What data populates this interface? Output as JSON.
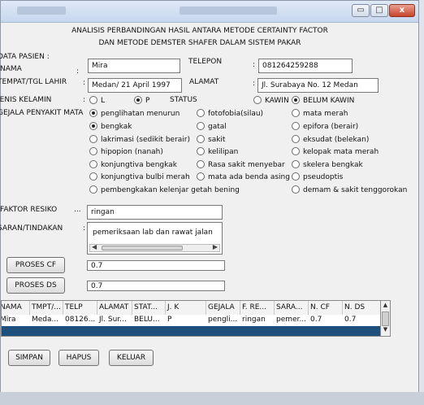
{
  "header": {
    "title_line1": "ANALISIS PERBANDINGAN HASIL ANTARA METODE CERTAINTY FACTOR",
    "title_line2": "DAN METODE DEMSTER SHAFER DALAM SISTEM PAKAR"
  },
  "window_controls": {
    "minimize": "▭",
    "maximize": "□",
    "close": "x"
  },
  "patient": {
    "section_label": "DATA PASIEN :",
    "nama_label": "NAMA",
    "nama_value": "Mira",
    "telepon_label": "TELEPON",
    "telepon_value": "081264259288",
    "ttl_label": "TEMPAT/TGL LAHIR",
    "ttl_value": "Medan/ 21 April 1997",
    "alamat_label": "ALAMAT",
    "alamat_value": "Jl. Surabaya No. 12 Medan",
    "jk_label": "JENIS KELAMIN",
    "jk_options": [
      "L",
      "P"
    ],
    "jk_selected": "P",
    "status_label": "STATUS",
    "status_options": [
      "KAWIN",
      "BELUM KAWIN"
    ],
    "status_selected": "BELUM KAWIN",
    "colon": ":"
  },
  "symptoms": {
    "label": "GEJALA PENYAKIT MATA",
    "col1": [
      "penglihatan menurun",
      "bengkak",
      "lakrimasi (sedikit berair)",
      "hipopion (nanah)",
      "konjungtiva bengkak",
      "konjungtiva bulbi merah",
      "pembengkakan kelenjar getah bening"
    ],
    "col2": [
      "fotofobia(silau)",
      "gatal",
      "sakit",
      "kelilipan",
      "Rasa sakit menyebar",
      "mata ada benda asing"
    ],
    "col3": [
      "mata merah",
      "epifora (berair)",
      "eksudat (belekan)",
      "kelopak mata merah",
      "skelera bengkak",
      "pseudoptis",
      "demam & sakit tenggorokan"
    ],
    "selected": [
      "penglihatan menurun",
      "bengkak"
    ]
  },
  "risk": {
    "label": "FAKTOR RESIKO",
    "separator": "...",
    "value": "ringan"
  },
  "advice": {
    "label": "SARAN/TINDAKAN",
    "colon": ":",
    "value": "pemeriksaan lab dan rawat jalan"
  },
  "buttons": {
    "proses_cf": "PROSES CF",
    "proses_ds": "PROSES DS",
    "simpan": "SIMPAN",
    "hapus": "HAPUS",
    "keluar": "KELUAR"
  },
  "results": {
    "cf_value": "0.7",
    "ds_value": "0.7"
  },
  "table": {
    "columns": [
      "NAMA",
      "TMPT/...",
      "TELP",
      "ALAMAT",
      "STAT...",
      "J. K",
      "GEJALA",
      "F. RE...",
      "SARA...",
      "N. CF",
      "N. DS"
    ],
    "rows": [
      [
        "Mira",
        "Meda...",
        "08126...",
        "Jl. Sur...",
        "BELU...",
        "P",
        "pengli...",
        "ringan",
        "pemer...",
        "0.7",
        "0.7"
      ]
    ]
  },
  "colors": {
    "selected_row": "#1f4f7c",
    "titlebar": "#c7d7ee",
    "close_button": "#c8442c"
  }
}
